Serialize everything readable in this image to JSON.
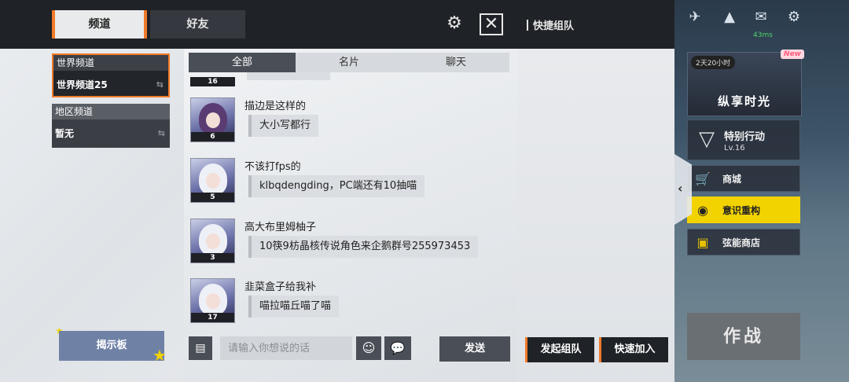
{
  "header": {
    "tabs": [
      {
        "label": "频道",
        "active": true
      },
      {
        "label": "好友",
        "active": false
      }
    ],
    "settings_icon": "gear-icon",
    "close_icon": "close-icon"
  },
  "channels": [
    {
      "title": "世界频道",
      "value": "世界频道25",
      "active": true
    },
    {
      "title": "地区频道",
      "value": "暂无",
      "active": false
    }
  ],
  "bulletin_board": {
    "label": "揭示板"
  },
  "chat": {
    "filters": [
      {
        "label": "全部",
        "active": true
      },
      {
        "label": "名片",
        "active": false
      },
      {
        "label": "聊天",
        "active": false
      }
    ],
    "partial_message": {
      "level": "16"
    },
    "messages": [
      {
        "username": "描边是这样的",
        "text": "大小写都行",
        "level": "6"
      },
      {
        "username": "不该打fps的",
        "text": "klbqdengding，PC端还有10抽喵",
        "level": "5"
      },
      {
        "username": "高大布里姆柚子",
        "text": "10筷9枋晶核传说角色来企鹅群号255973453",
        "level": "3"
      },
      {
        "username": "韭菜盒子给我补",
        "text": "喵拉喵丘喵了喵",
        "level": "17"
      }
    ],
    "input": {
      "placeholder": "请输入你想说的话",
      "value": ""
    },
    "send_label": "发送"
  },
  "team_panel": {
    "title": "快捷组队",
    "create_label": "发起组队",
    "quick_join_label": "快速加入"
  },
  "game_bg": {
    "timer": "2天20小时",
    "new_badge": "New",
    "banner_title": "纵享时光",
    "signal": "43ms",
    "special_title": "特别行动",
    "special_level": "Lv.16",
    "menu": [
      {
        "label": "商城"
      },
      {
        "label": "意识重构"
      },
      {
        "label": "弦能商店"
      }
    ],
    "combat_label": "作战"
  }
}
